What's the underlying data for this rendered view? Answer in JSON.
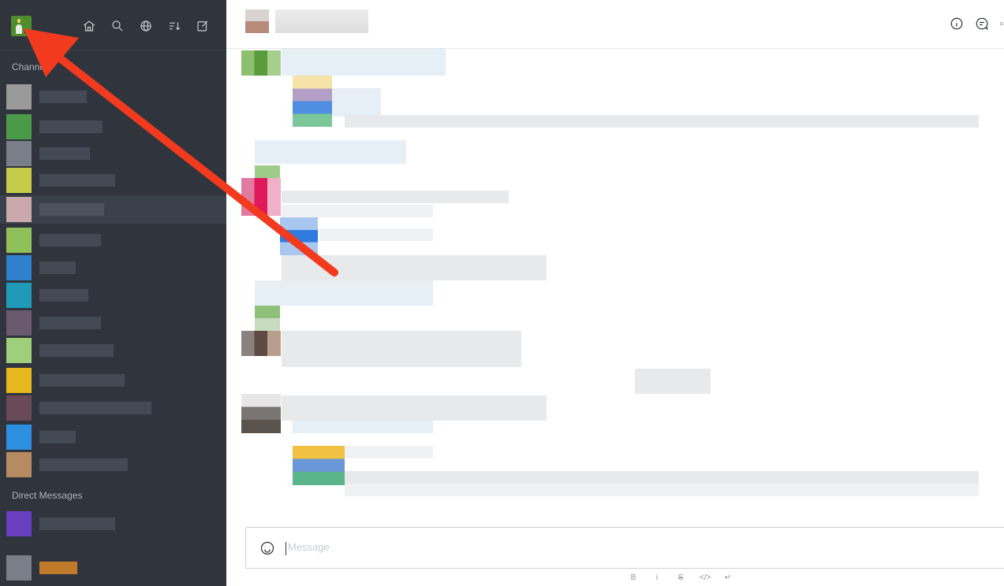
{
  "sidebar": {
    "channels_label": "Channels",
    "dm_label": "Direct Messages",
    "top_icons": [
      "home-icon",
      "search-icon",
      "globe-icon",
      "sort-icon",
      "compose-icon"
    ],
    "channel_colors": [
      "#9a9a9a",
      "#4b9a4a",
      "#7a7e88",
      "#c6cc4a",
      "#c9a9ab",
      "#8fc05a",
      "#2f80cf",
      "#1f9ab8",
      "#6a5a70",
      "#9fcf7a",
      "#e5b81f",
      "#6a4a58",
      "#2d8fe0",
      "#b58c62"
    ],
    "dm_colors": [
      "#6a3fbf",
      "#c07a2a"
    ]
  },
  "header": {
    "icons": [
      "info-icon",
      "discussion-icon"
    ]
  },
  "composer": {
    "placeholder": "Message",
    "format_bold": "B",
    "format_italic": "i",
    "format_strike": "S",
    "format_code": "</>",
    "format_enter": "↵"
  }
}
